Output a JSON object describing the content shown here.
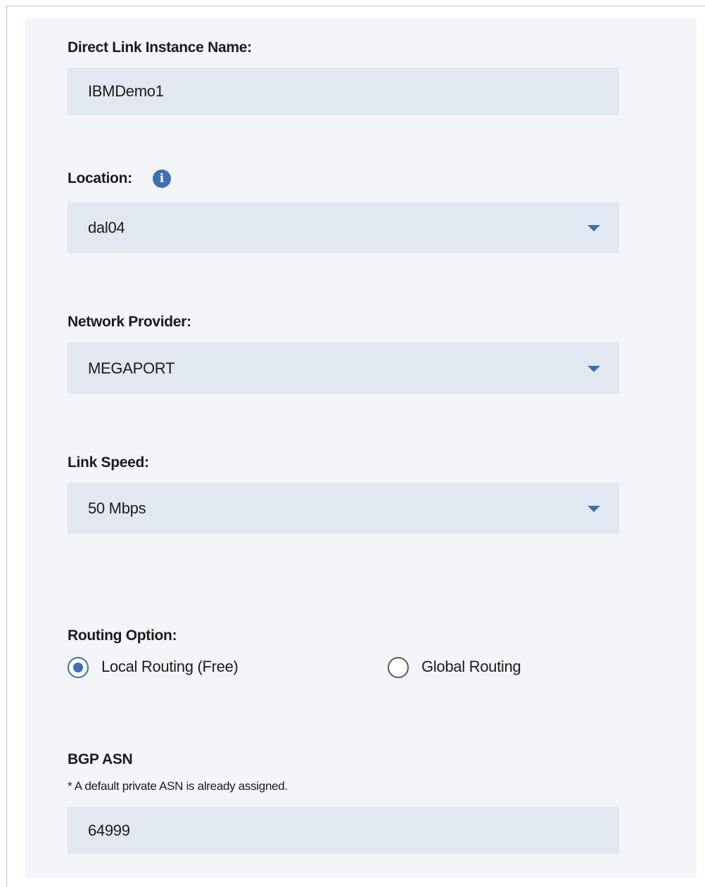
{
  "form": {
    "instance_name": {
      "label": "Direct Link Instance Name:",
      "value": "IBMDemo1"
    },
    "location": {
      "label": "Location:",
      "info_icon": "info-icon",
      "value": "dal04"
    },
    "network_provider": {
      "label": "Network Provider:",
      "value": "MEGAPORT"
    },
    "link_speed": {
      "label": "Link Speed:",
      "value": "50 Mbps"
    },
    "routing_option": {
      "label": "Routing Option:",
      "options": [
        {
          "label": "Local Routing (Free)",
          "selected": true
        },
        {
          "label": "Global Routing",
          "selected": false
        }
      ]
    },
    "bgp_asn": {
      "label": "BGP ASN",
      "note": "* A default private ASN is already assigned.",
      "value": "64999"
    }
  },
  "colors": {
    "accent": "#3d70b2",
    "panel_background": "#f3f5f9",
    "field_background": "#e2e8f2",
    "text": "#1b1b1b"
  }
}
